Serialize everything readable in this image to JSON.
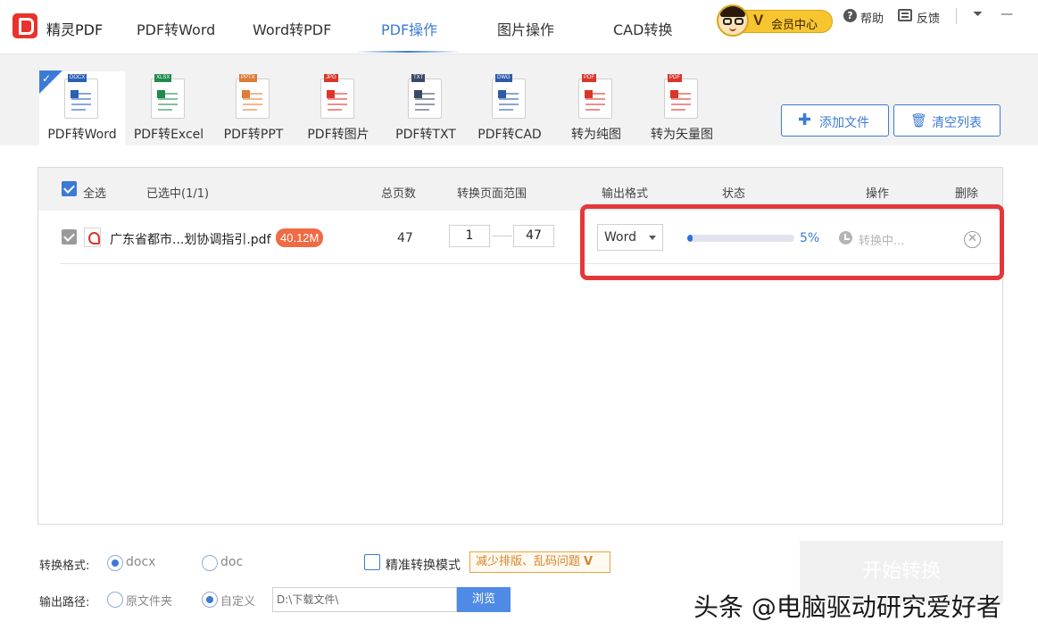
{
  "app": {
    "name": "精灵PDF"
  },
  "nav": {
    "tabs": [
      {
        "label": "PDF转Word"
      },
      {
        "label": "Word转PDF"
      },
      {
        "label": "PDF操作"
      },
      {
        "label": "图片操作"
      },
      {
        "label": "CAD转换"
      }
    ],
    "active": "PDF操作"
  },
  "header": {
    "vip_label": "会员中心",
    "vip_mark": "V",
    "help": "帮助",
    "feedback": "反馈"
  },
  "tools": [
    {
      "label": "PDF转Word",
      "tag": "DOCX",
      "tag_color": "#2b5fb4"
    },
    {
      "label": "PDF转Excel",
      "tag": "XLSX",
      "tag_color": "#1f8a4c"
    },
    {
      "label": "PDF转PPT",
      "tag": "PPTX",
      "tag_color": "#e07b39"
    },
    {
      "label": "PDF转图片",
      "tag": "JPG",
      "tag_color": "#d8362a"
    },
    {
      "label": "PDF转TXT",
      "tag": "TXT",
      "tag_color": "#3a4a66"
    },
    {
      "label": "PDF转CAD",
      "tag": "DWG",
      "tag_color": "#2d5aa8"
    },
    {
      "label": "转为纯图",
      "tag": "PDF",
      "tag_color": "#d8362a"
    },
    {
      "label": "转为矢量图",
      "tag": "PDF",
      "tag_color": "#d8362a"
    }
  ],
  "actions": {
    "add_file": "添加文件",
    "clear_list": "清空列表"
  },
  "table": {
    "select_all": "全选",
    "selected_count": "已选中(1/1)",
    "columns": {
      "pages": "总页数",
      "range": "转换页面范围",
      "format": "输出格式",
      "status": "状态",
      "operation": "操作",
      "delete": "删除"
    },
    "rows": [
      {
        "file_name": "广东省都市...划协调指引.pdf",
        "size": "40.12M",
        "pages": "47",
        "range_from": "1",
        "range_to": "47",
        "format": "Word",
        "progress_pct": 5,
        "progress_text": "5%",
        "operation": "转换中..."
      }
    ]
  },
  "bottom": {
    "format_label": "转换格式:",
    "format_options": [
      "docx",
      "doc"
    ],
    "format_selected": "docx",
    "precise_mode": "精准转换模式",
    "precise_tip": "减少排版、乱码问题",
    "path_label": "输出路径:",
    "path_options": [
      "原文件夹",
      "自定义"
    ],
    "path_selected": "自定义",
    "path_value": "D:\\下载文件\\",
    "browse": "浏览",
    "start": "开始转换"
  },
  "watermark": "头条 @电脑驱动研究爱好者",
  "colors": {
    "accent": "#3b7bd6",
    "highlight": "#e5373a",
    "badge": "#ef6b45",
    "logo": "#e8322b"
  }
}
